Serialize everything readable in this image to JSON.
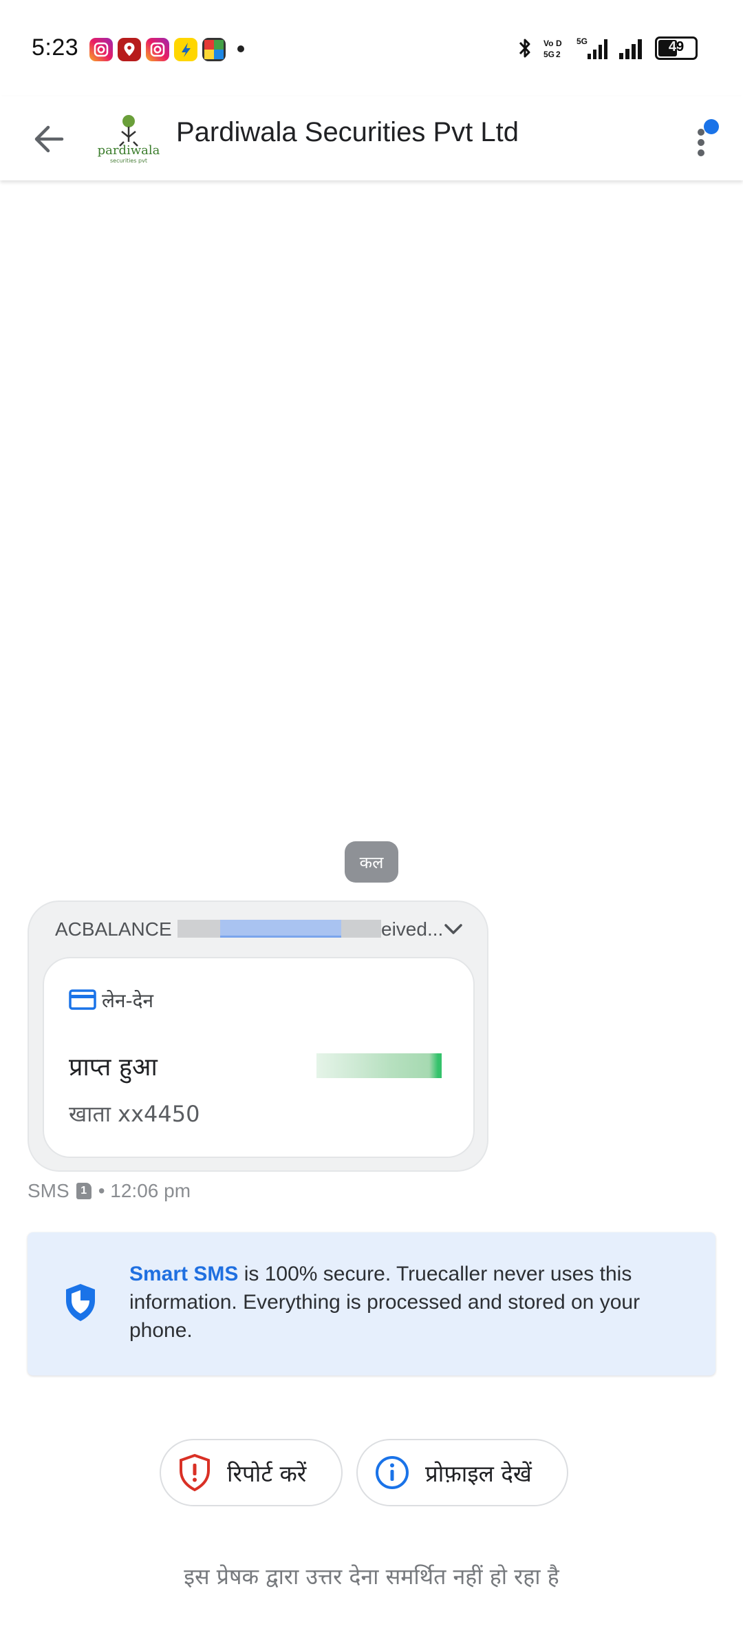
{
  "status_bar": {
    "time": "5:23",
    "battery": "49",
    "notification_icons": [
      "instagram-icon",
      "maps-pin-icon",
      "instagram-icon",
      "flipkart-icon",
      "grid-app-icon"
    ]
  },
  "header": {
    "title": "Pardiwala Securities Pvt Ltd",
    "logo_text": "pardiwala",
    "logo_subtext": "securities pvt"
  },
  "conversation": {
    "date_chip": "कल",
    "message": {
      "preview_prefix": "ACBALANCE",
      "preview_suffix": "eived...",
      "card": {
        "category": "लेन-देन",
        "status": "प्राप्त हुआ",
        "account": "खाता xx4450"
      },
      "meta_type": "SMS",
      "meta_sim": "1",
      "meta_time": "• 12:06 pm"
    }
  },
  "secure_notice": {
    "highlight": "Smart SMS",
    "text": " is 100% secure. Truecaller never uses this information. Everything is processed and stored on your phone."
  },
  "actions": {
    "report": "रिपोर्ट करें",
    "profile": "प्रोफ़ाइल देखें"
  },
  "footer": {
    "note": "इस प्रेषक द्वारा उत्तर देना समर्थित नहीं हो रहा है"
  },
  "colors": {
    "accent_blue": "#1a73e8",
    "report_red": "#d93025",
    "secure_bg": "#e6effc"
  }
}
